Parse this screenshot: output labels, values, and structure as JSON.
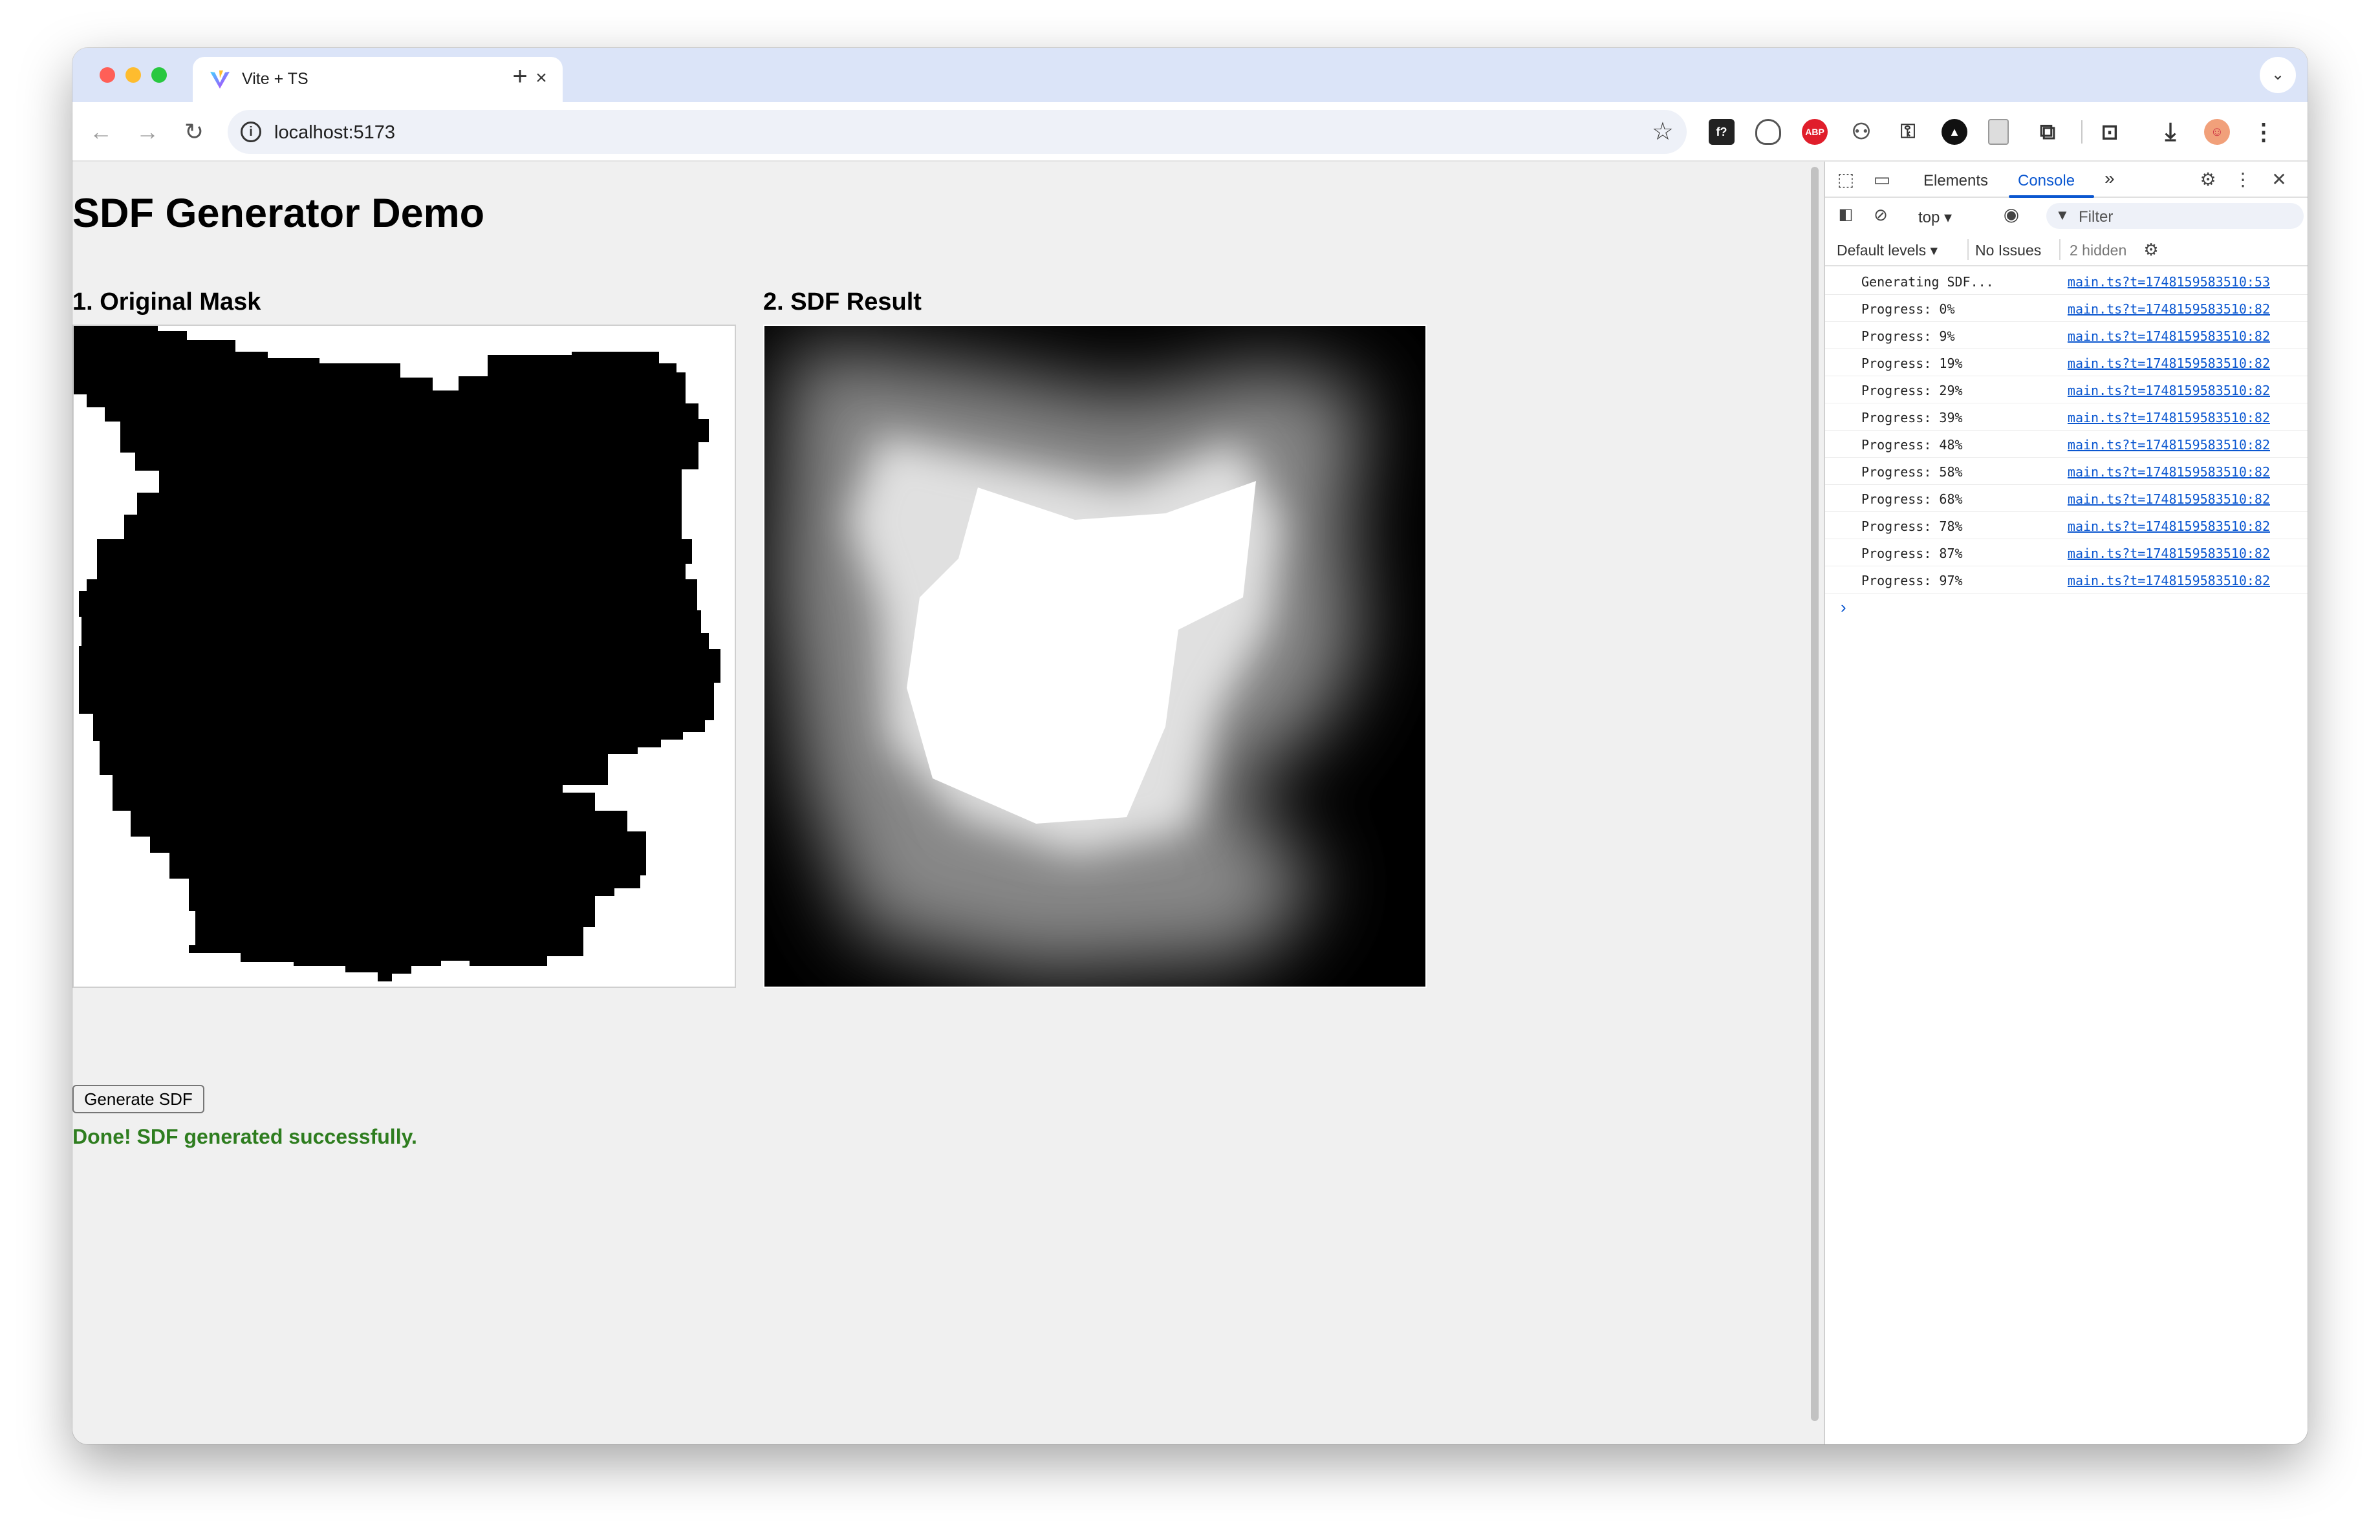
{
  "browser": {
    "tab_title": "Vite + TS",
    "tab_close": "×",
    "new_tab": "+",
    "url": "localhost:5173",
    "info_glyph": "i",
    "star_glyph": "☆",
    "tab_menu_glyph": "⌄",
    "nav": {
      "back": "←",
      "forward": "→",
      "reload": "↻"
    },
    "extensions": [
      "f?",
      "",
      "ABP",
      "⚇",
      "⚿",
      "▲",
      "",
      "⧉",
      "⊡",
      "⤓",
      "☺",
      "⋮"
    ]
  },
  "page": {
    "title": "SDF Generator Demo",
    "section_mask": "1. Original Mask",
    "section_sdf": "2. SDF Result",
    "generate_button": "Generate SDF",
    "status": "Done! SDF generated successfully."
  },
  "devtools": {
    "tabs": {
      "elements": "Elements",
      "console": "Console",
      "more": "»"
    },
    "context": "top ▾",
    "filter_placeholder": "Filter",
    "levels": "Default levels ▾",
    "issues": "No Issues",
    "hidden": "2 hidden",
    "logs": [
      {
        "msg": "Generating SDF...",
        "src": "main.ts?t=1748159583510:53"
      },
      {
        "msg": "Progress: 0%",
        "src": "main.ts?t=1748159583510:82"
      },
      {
        "msg": "Progress: 9%",
        "src": "main.ts?t=1748159583510:82"
      },
      {
        "msg": "Progress: 19%",
        "src": "main.ts?t=1748159583510:82"
      },
      {
        "msg": "Progress: 29%",
        "src": "main.ts?t=1748159583510:82"
      },
      {
        "msg": "Progress: 39%",
        "src": "main.ts?t=1748159583510:82"
      },
      {
        "msg": "Progress: 48%",
        "src": "main.ts?t=1748159583510:82"
      },
      {
        "msg": "Progress: 58%",
        "src": "main.ts?t=1748159583510:82"
      },
      {
        "msg": "Progress: 68%",
        "src": "main.ts?t=1748159583510:82"
      },
      {
        "msg": "Progress: 78%",
        "src": "main.ts?t=1748159583510:82"
      },
      {
        "msg": "Progress: 87%",
        "src": "main.ts?t=1748159583510:82"
      },
      {
        "msg": "Progress: 97%",
        "src": "main.ts?t=1748159583510:82"
      }
    ],
    "prompt": "›"
  },
  "colors": {
    "status_green": "#2e7d1f",
    "link_blue": "#0b57d0",
    "tabstrip": "#dbe4f8"
  }
}
